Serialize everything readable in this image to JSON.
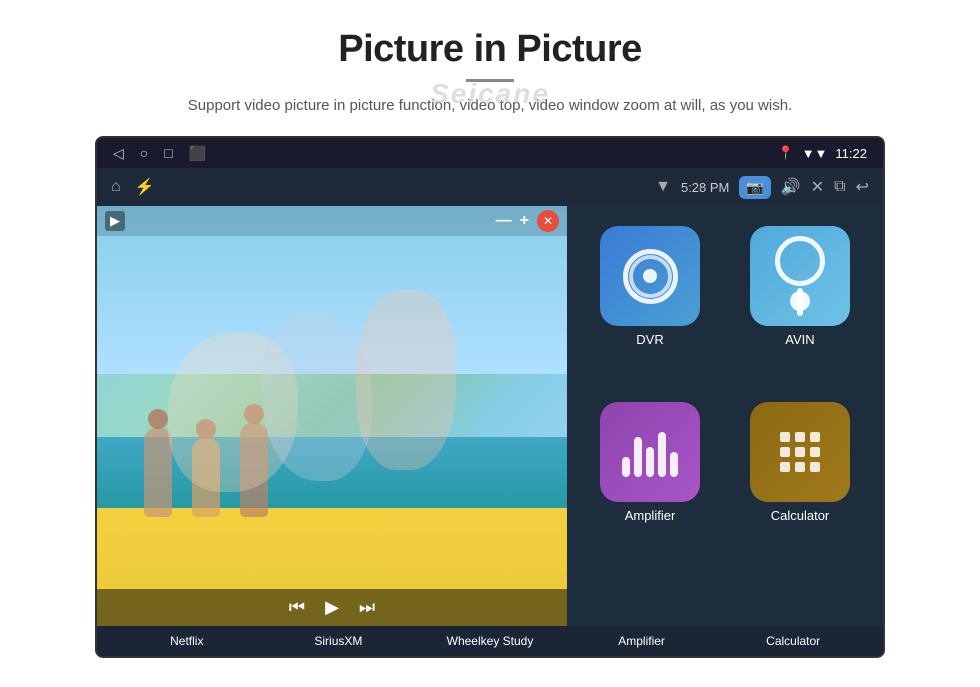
{
  "page": {
    "title": "Picture in Picture",
    "watermark": "Seicane",
    "subtitle": "Support video picture in picture function, video top, video window zoom at will, as you wish."
  },
  "device": {
    "status_bar": {
      "time": "11:22",
      "nav_back": "◁",
      "nav_home": "○",
      "nav_recent": "□",
      "nav_screenshot": "⬛"
    },
    "toolbar": {
      "home_icon": "⌂",
      "usb_icon": "⚡",
      "wifi": "▼",
      "time": "5:28 PM",
      "camera_icon": "📷",
      "volume_icon": "🔊",
      "close_icon": "✕",
      "pip_icon": "⧉",
      "back_icon": "↩"
    },
    "pip": {
      "minimize": "—",
      "expand": "+",
      "close": "✕"
    },
    "video_controls": {
      "prev": "⏮",
      "play": "▶",
      "next": "⏭"
    }
  },
  "apps": {
    "top_row": [
      {
        "label": "Netflix",
        "color": "green"
      },
      {
        "label": "SiriusXM",
        "color": "pink"
      },
      {
        "label": "Wheelkey Study",
        "color": "purple"
      }
    ],
    "grid": [
      {
        "id": "dvr",
        "label": "DVR",
        "bg": "dvr-bg",
        "icon": "dvr"
      },
      {
        "id": "avin",
        "label": "AVIN",
        "bg": "avin-bg",
        "icon": "avin"
      },
      {
        "id": "amplifier",
        "label": "Amplifier",
        "bg": "amplifier-bg",
        "icon": "amp"
      },
      {
        "id": "calculator",
        "label": "Calculator",
        "bg": "calculator-bg",
        "icon": "calc"
      }
    ],
    "bottom_labels": [
      "Netflix",
      "SiriusXM",
      "Wheelkey Study",
      "Amplifier",
      "Calculator"
    ]
  },
  "colors": {
    "accent": "#4a90d9",
    "bg_dark": "#1a1a2e",
    "bg_medium": "#1e2d3d",
    "text_white": "#ffffff",
    "text_light": "#cccccc"
  }
}
